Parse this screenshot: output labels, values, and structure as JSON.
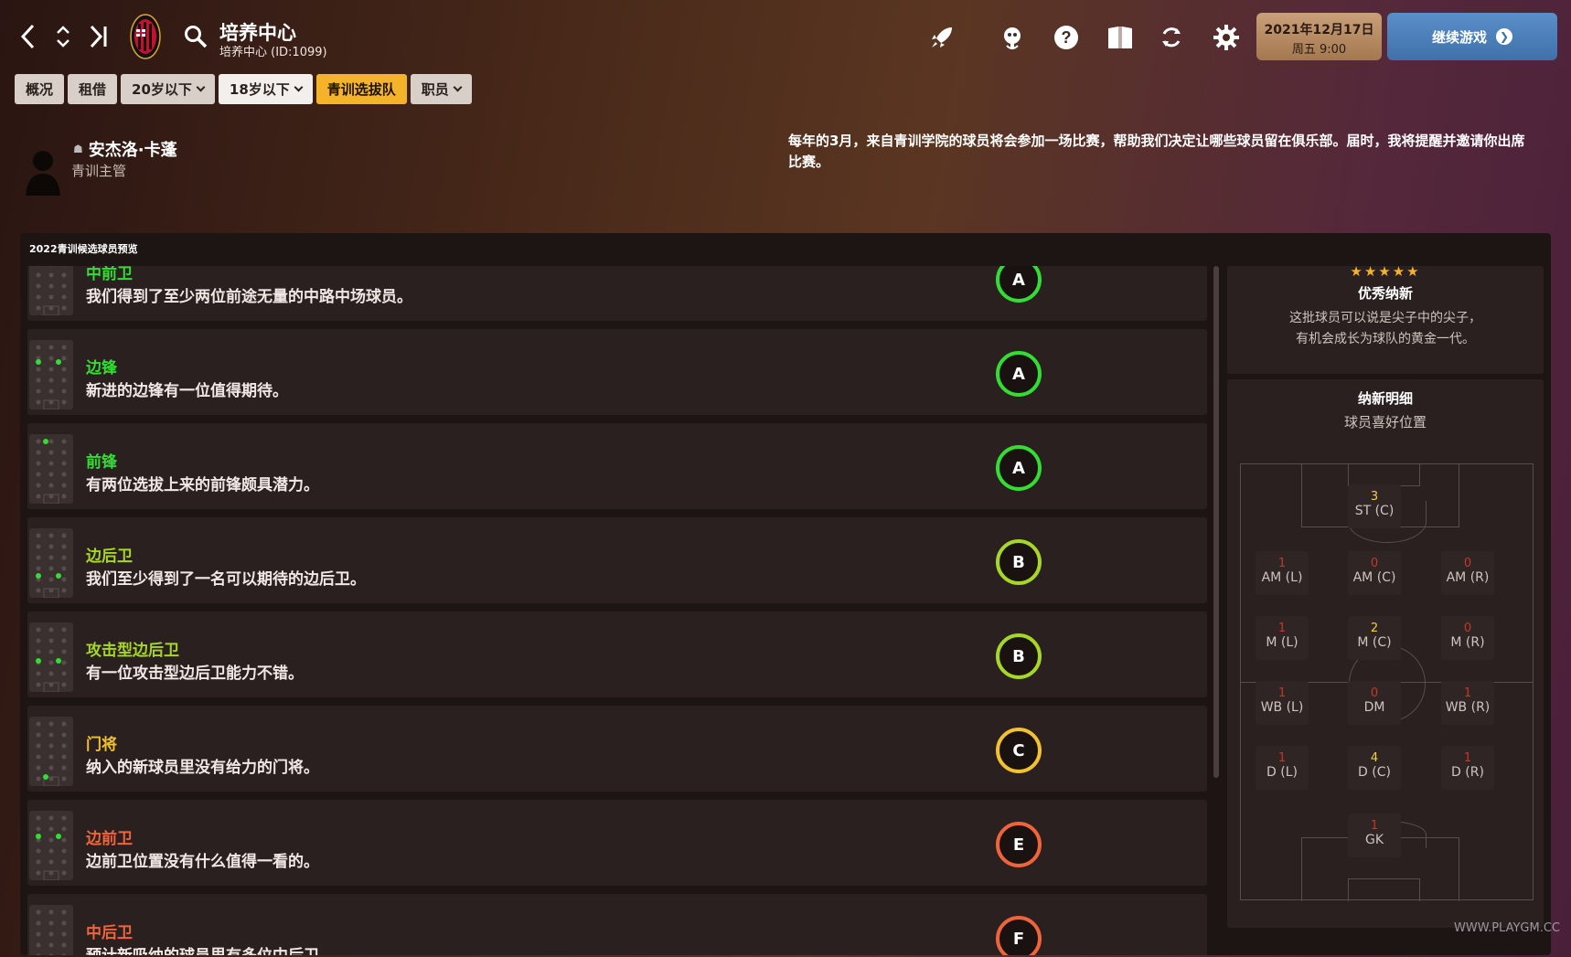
{
  "header": {
    "title": "培养中心",
    "subtitle": "培养中心 (ID:1099)",
    "date": "2021年12月17日",
    "time": "周五 9:00",
    "continue_label": "继续游戏"
  },
  "tabs": [
    {
      "label": "概况",
      "dropdown": false,
      "style": "normal"
    },
    {
      "label": "租借",
      "dropdown": false,
      "style": "normal"
    },
    {
      "label": "20岁以下",
      "dropdown": true,
      "style": "normal"
    },
    {
      "label": "18岁以下",
      "dropdown": true,
      "style": "white"
    },
    {
      "label": "青训选拔队",
      "dropdown": false,
      "style": "active"
    },
    {
      "label": "职员",
      "dropdown": true,
      "style": "normal"
    }
  ],
  "staff": {
    "name": "安杰洛·卡蓬",
    "role": "青训主管",
    "message": "每年的3月，来自青训学院的球员将会参加一场比赛，帮助我们决定让哪些球员留在俱乐部。届时，我将提醒并邀请你出席比赛。"
  },
  "panel_title": "2022青训候选球员预览",
  "rows": [
    {
      "title": "中前卫",
      "desc": "我们得到了至少两位前途无量的中路中场球员。",
      "grade": "A",
      "color": "#33dd33",
      "dots": "cm"
    },
    {
      "title": "边锋",
      "desc": "新进的边锋有一位值得期待。",
      "grade": "A",
      "color": "#33dd33",
      "dots": "w"
    },
    {
      "title": "前锋",
      "desc": "有两位选拔上来的前锋颇具潜力。",
      "grade": "A",
      "color": "#33dd33",
      "dots": "st"
    },
    {
      "title": "边后卫",
      "desc": "我们至少得到了一名可以期待的边后卫。",
      "grade": "B",
      "color": "#a6d628",
      "dots": "fb"
    },
    {
      "title": "攻击型边后卫",
      "desc": "有一位攻击型边后卫能力不错。",
      "grade": "B",
      "color": "#a6d628",
      "dots": "wb"
    },
    {
      "title": "门将",
      "desc": "纳入的新球员里没有给力的门将。",
      "grade": "C",
      "color": "#f2c12e",
      "dots": "gk"
    },
    {
      "title": "边前卫",
      "desc": "边前卫位置没有什么值得一看的。",
      "grade": "E",
      "color": "#f0643c",
      "dots": "wm"
    },
    {
      "title": "中后卫",
      "desc": "预计新吸纳的球员里有多位中后卫。",
      "grade": "F",
      "color": "#f0643c",
      "dots": "cb"
    }
  ],
  "summary": {
    "stars": "★★★★★",
    "title": "优秀纳新",
    "line1": "这批球员可以说是尖子中的尖子，",
    "line2": "有机会成长为球队的黄金一代。"
  },
  "intake": {
    "title": "纳新明细",
    "subtitle": "球员喜好位置",
    "positions": [
      {
        "label": "ST (C)",
        "count": "3",
        "hot": true
      },
      {
        "label": "AM (L)",
        "count": "1",
        "hot": false
      },
      {
        "label": "AM (C)",
        "count": "0",
        "hot": false
      },
      {
        "label": "AM (R)",
        "count": "0",
        "hot": false
      },
      {
        "label": "M (L)",
        "count": "1",
        "hot": false
      },
      {
        "label": "M (C)",
        "count": "2",
        "hot": true
      },
      {
        "label": "M (R)",
        "count": "0",
        "hot": false
      },
      {
        "label": "WB (L)",
        "count": "1",
        "hot": false
      },
      {
        "label": "DM",
        "count": "0",
        "hot": false
      },
      {
        "label": "WB (R)",
        "count": "1",
        "hot": false
      },
      {
        "label": "D (L)",
        "count": "1",
        "hot": false
      },
      {
        "label": "D (C)",
        "count": "4",
        "hot": true
      },
      {
        "label": "D (R)",
        "count": "1",
        "hot": false
      },
      {
        "label": "GK",
        "count": "1",
        "hot": false
      }
    ]
  },
  "watermark": "WWW.PLAYGM.CC",
  "colors": {
    "accent": "#f4b328",
    "continue": "#4a7fbc",
    "grade_a": "#33dd33",
    "grade_b": "#a6d628",
    "grade_c": "#f2c12e",
    "grade_low": "#f0643c"
  }
}
